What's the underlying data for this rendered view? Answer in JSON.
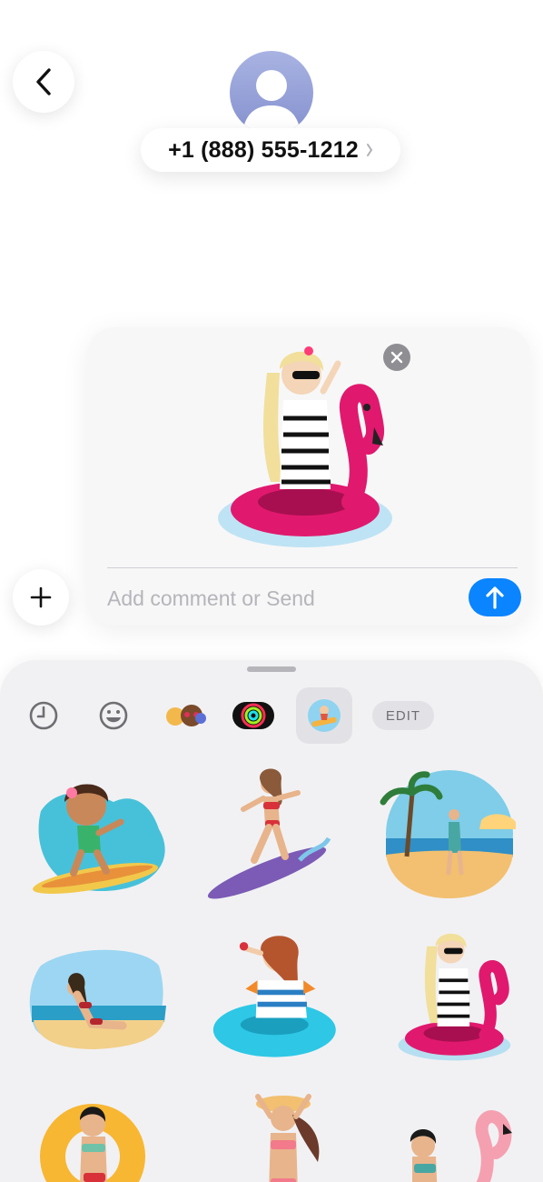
{
  "header": {
    "contact_number": "+1 (888) 555-1212"
  },
  "composer": {
    "comment_placeholder": "Add comment or Send"
  },
  "drawer": {
    "edit_label": "EDIT",
    "tabs": [
      "recents",
      "emoji",
      "memoji",
      "activity",
      "stickers"
    ],
    "selected_tab": "stickers"
  },
  "stickers": [
    "surfing-girl-cartoon",
    "surfing-woman-bikini",
    "beach-palm-woman",
    "bikini-beach-sunbath",
    "woman-blue-swim-ring",
    "woman-flamingo-float",
    "woman-yellow-swim-ring",
    "woman-sun-hat",
    "woman-pink-flamingo"
  ],
  "colors": {
    "accent": "#0a84ff",
    "drawer_bg": "#f1f1f3",
    "avatar": "#8c97d1"
  }
}
